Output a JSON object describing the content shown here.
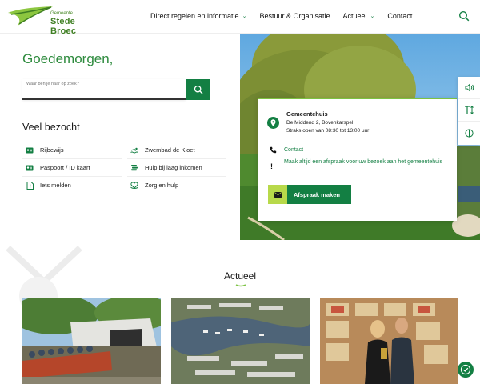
{
  "brand": {
    "small": "Gemeente",
    "name": "Stede Broec"
  },
  "nav": [
    {
      "label": "Direct regelen en informatie",
      "chevron": true
    },
    {
      "label": "Bestuur & Organisatie",
      "chevron": false
    },
    {
      "label": "Actueel",
      "chevron": true
    },
    {
      "label": "Contact",
      "chevron": false
    }
  ],
  "hero": {
    "greeting": "Goedemorgen,",
    "search_placeholder": "Waar ben je naar op zoek?"
  },
  "popular": {
    "title": "Veel bezocht",
    "items": [
      {
        "label": "Rijbewijs",
        "icon": "id-card-icon"
      },
      {
        "label": "Zwembad de Kloet",
        "icon": "swimmer-icon"
      },
      {
        "label": "Paspoort / ID kaart",
        "icon": "id-card-icon"
      },
      {
        "label": "Hulp bij laag inkomen",
        "icon": "coins-icon"
      },
      {
        "label": "Iets melden",
        "icon": "report-icon"
      },
      {
        "label": "Zorg en hulp",
        "icon": "care-icon"
      }
    ]
  },
  "card": {
    "title": "Gemeentehuis",
    "address": "De Middend 2, Bovenkarspel",
    "hours": "Straks open van 08:30 tot 13:00 uur",
    "contact": "Contact",
    "note": "Maak altijd een afspraak voor uw bezoek aan het gemeentehuis",
    "button": "Afspraak maken"
  },
  "news": {
    "title": "Actueel"
  },
  "colors": {
    "primary": "#137f43",
    "accent": "#7cc242",
    "lime": "#b8d94a"
  }
}
